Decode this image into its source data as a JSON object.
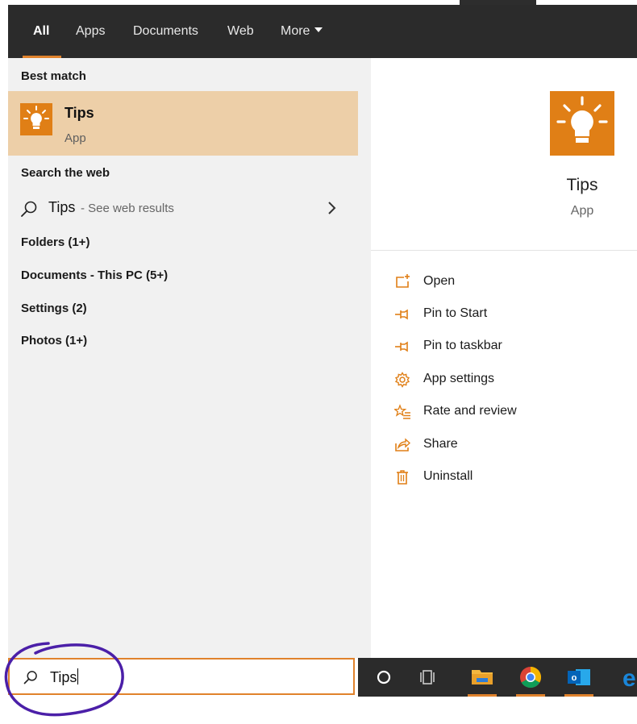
{
  "tabs": [
    {
      "label": "All",
      "active": true
    },
    {
      "label": "Apps"
    },
    {
      "label": "Documents"
    },
    {
      "label": "Web"
    },
    {
      "label": "More"
    }
  ],
  "best_match": {
    "header": "Best match",
    "name": "Tips",
    "type": "App",
    "icon": "lightbulb-icon"
  },
  "search_web": {
    "header": "Search the web",
    "term": "Tips",
    "hint": "- See web results"
  },
  "categories": [
    "Folders (1+)",
    "Documents - This PC (5+)",
    "Settings (2)",
    "Photos (1+)"
  ],
  "preview": {
    "name": "Tips",
    "type": "App",
    "actions": [
      {
        "label": "Open",
        "icon": "open-icon"
      },
      {
        "label": "Pin to Start",
        "icon": "pin-icon"
      },
      {
        "label": "Pin to taskbar",
        "icon": "pin-icon"
      },
      {
        "label": "App settings",
        "icon": "gear-icon"
      },
      {
        "label": "Rate and review",
        "icon": "star-list-icon"
      },
      {
        "label": "Share",
        "icon": "share-icon"
      },
      {
        "label": "Uninstall",
        "icon": "trash-icon"
      }
    ]
  },
  "search_box": {
    "value": "Tips"
  },
  "taskbar": [
    "cortana-icon",
    "task-view-icon",
    "file-explorer-icon",
    "chrome-icon",
    "outlook-icon",
    "edge-icon"
  ],
  "colors": {
    "accent": "#e07f16",
    "highlight": "#edcfa8",
    "dark": "#2b2b2b",
    "annotation": "#4b1fa8"
  }
}
